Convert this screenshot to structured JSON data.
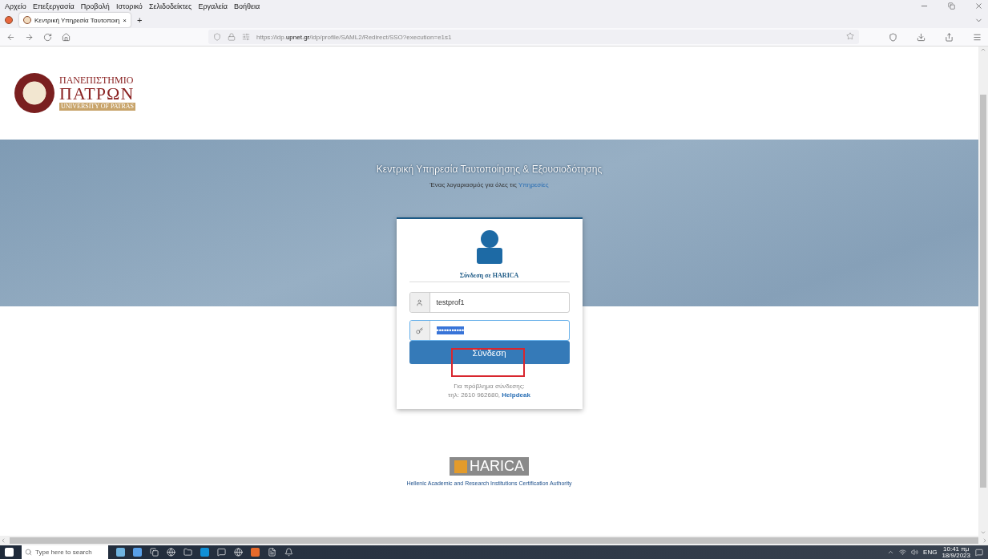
{
  "menu_bar": [
    "Αρχείο",
    "Επεξεργασία",
    "Προβολή",
    "Ιστορικό",
    "Σελιδοδείκτες",
    "Εργαλεία",
    "Βοήθεια"
  ],
  "tabs": [
    {
      "title": "Κεντρική Υπηρεσία Ταυτοποιη",
      "close": "×",
      "selected": true
    }
  ],
  "new_tab": "+",
  "address_bar": {
    "url": "https://idp.**upnet.gr**/idp/profile/SAML2/Redirect/SSO?execution=e1s1"
  },
  "logo": {
    "line_1": "ΠΑΝΕΠΙΣΤΗΜΙΟ",
    "line_2": "ΠΑΤΡΩΝ",
    "line_3": "UNIVERSITY OF PATRAS"
  },
  "banner": {
    "title": "Κεντρική Υπηρεσία Ταυτοποίησης & Εξουσιοδότησης",
    "subtitle": "Ένας λογαριασμός για όλες τις ",
    "subtitle_link": "Υπηρεσίες"
  },
  "login": {
    "heading": "Σύνδεση σε HARICA",
    "username": "testprof1",
    "password": "•••••••••••",
    "password_selected": true,
    "button": "Σύνδεση",
    "button_highlighted": true,
    "help_line_1": "Για πρόβλημα σύνδεσης:",
    "help_line_2": "τηλ: 2610 962680, ",
    "help_link": "Helpdeak"
  },
  "footer": {
    "logo_text": "HARICA",
    "caption": "Hellenic Academic and Research Institutions Certification Authority"
  },
  "taskbar": {
    "search_placeholder": "Type here to search",
    "language": "ENG",
    "time": "10:41 πμ",
    "date": "18/9/2023"
  }
}
